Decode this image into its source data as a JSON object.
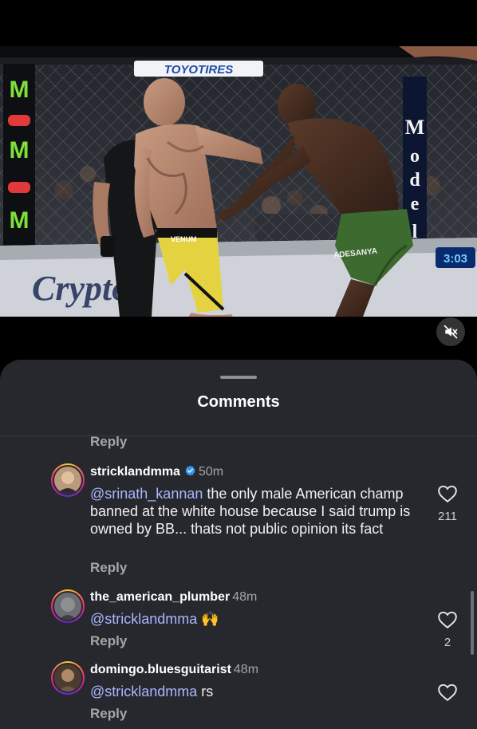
{
  "video": {
    "banner_text": "TOYOTIRES",
    "shorts_text": "VENUM",
    "fighter_name_text": "ADESANYA",
    "timer_text": "3:03",
    "post_text": "Modelo"
  },
  "sheet": {
    "title": "Comments",
    "top_reply_label": "Reply"
  },
  "comments": [
    {
      "username": "stricklandmma",
      "verified": true,
      "time": "50m",
      "mention": "@srinath_kannan",
      "text": " the only male American champ banned at the white house because I said trump is owned by BB... thats not public opinion its fact",
      "reply_label": "Reply",
      "likes": "211"
    },
    {
      "username": "the_american_plumber",
      "verified": false,
      "time": "48m",
      "mention": "@stricklandmma",
      "text": " 🙌",
      "reply_label": "Reply",
      "likes": "2"
    },
    {
      "username": "domingo.bluesguitarist",
      "verified": false,
      "time": "48m",
      "mention": "@stricklandmma",
      "text": " rs",
      "reply_label": "Reply",
      "likes": ""
    }
  ],
  "icons": {
    "mute": "speaker-muted-icon",
    "like": "heart-icon",
    "verified": "verified-badge-icon"
  },
  "colors": {
    "sheet_bg": "#26282d",
    "mention": "#a9b8ff",
    "verified": "#3897f0"
  }
}
